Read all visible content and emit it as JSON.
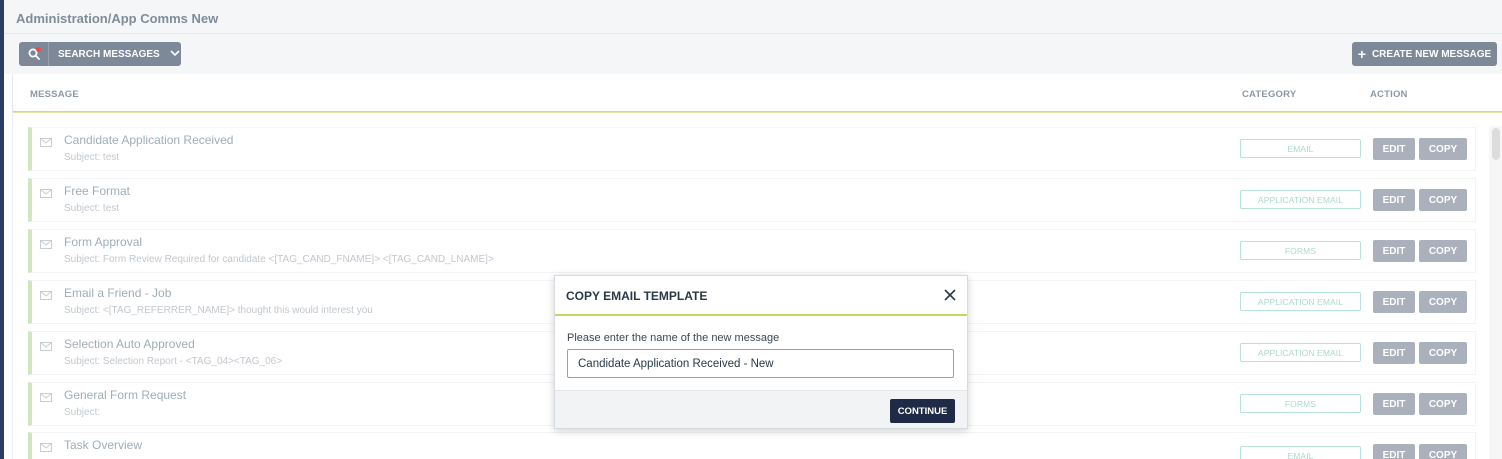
{
  "page": {
    "title": "Administration/App Comms New"
  },
  "toolbar": {
    "search_label": "SEARCH MESSAGES",
    "create_label": "CREATE NEW MESSAGE",
    "button_color": "#7d8898",
    "notification_dot_color": "#e94b4b"
  },
  "table": {
    "columns": {
      "message": "MESSAGE",
      "category": "CATEGORY",
      "action": "ACTION"
    },
    "edit_label": "EDIT",
    "copy_label": "COPY",
    "rows": [
      {
        "title": "Candidate Application Received",
        "subject": "Subject: test",
        "category": "EMAIL"
      },
      {
        "title": "Free Format",
        "subject": "Subject: test",
        "category": "APPLICATION EMAIL"
      },
      {
        "title": "Form Approval",
        "subject": "Subject: Form Review Required for candidate <[TAG_CAND_FNAME]> <[TAG_CAND_LNAME]>",
        "category": "FORMS"
      },
      {
        "title": "Email a Friend - Job",
        "subject": "Subject: <[TAG_REFERRER_NAME]> thought this would interest you",
        "category": "APPLICATION EMAIL"
      },
      {
        "title": "Selection Auto Approved",
        "subject": "Subject: Selection Report - <TAG_04><TAG_06>",
        "category": "APPLICATION EMAIL"
      },
      {
        "title": "General Form Request",
        "subject": "Subject:",
        "category": "FORMS"
      },
      {
        "title": "Task Overview",
        "subject": "",
        "category": "EMAIL"
      }
    ]
  },
  "modal": {
    "title": "COPY EMAIL TEMPLATE",
    "prompt": "Please enter the name of the new message",
    "input_value": "Candidate Application Received - New",
    "continue_label": "CONTINUE",
    "accent_color": "#c2d95f"
  },
  "icons": {
    "search": "search-icon",
    "chevron": "chevron-down-icon",
    "plus": "plus-icon",
    "mail": "envelope-icon",
    "close": "close-icon"
  }
}
